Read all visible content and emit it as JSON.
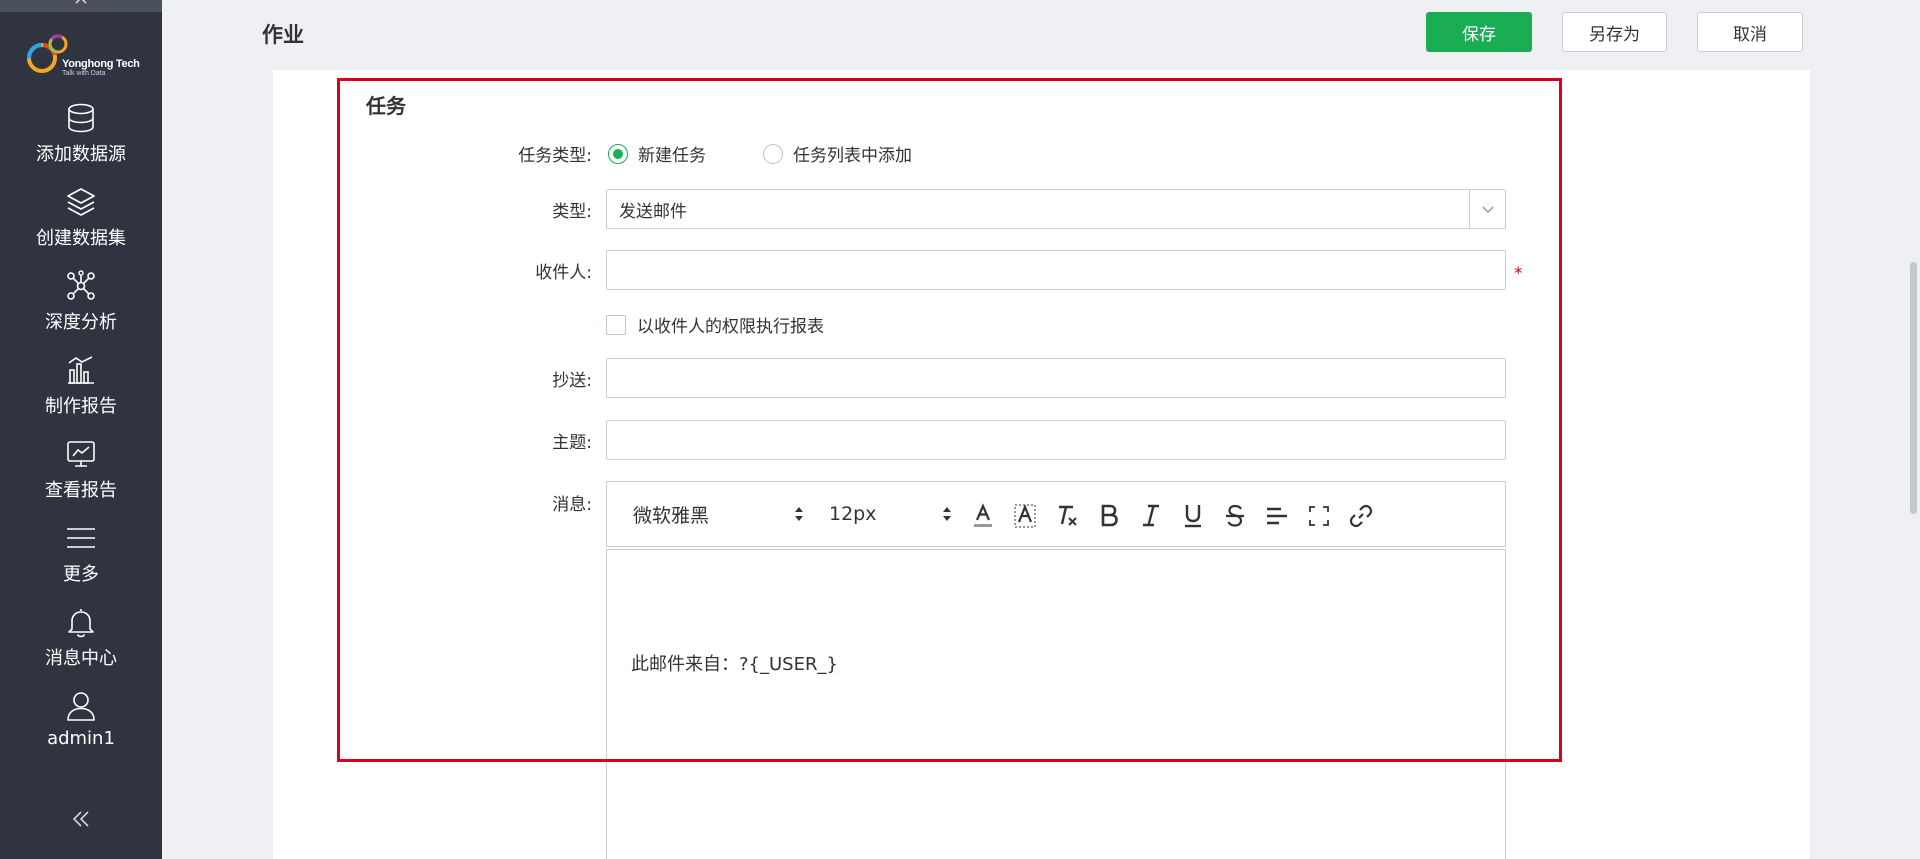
{
  "sidebar": {
    "logo": {
      "name": "Yonghong Tech",
      "tagline": "Talk with Data"
    },
    "items": [
      {
        "label": "添加数据源",
        "icon": "database-icon"
      },
      {
        "label": "创建数据集",
        "icon": "layers-icon"
      },
      {
        "label": "深度分析",
        "icon": "network-icon"
      },
      {
        "label": "制作报告",
        "icon": "bar-chart-icon"
      },
      {
        "label": "查看报告",
        "icon": "monitor-chart-icon"
      },
      {
        "label": "更多",
        "icon": "menu-icon"
      },
      {
        "label": "消息中心",
        "icon": "bell-icon"
      },
      {
        "label": "admin1",
        "icon": "user-icon"
      }
    ]
  },
  "header": {
    "title": "作业",
    "save_label": "保存",
    "save_as_label": "另存为",
    "cancel_label": "取消"
  },
  "task": {
    "section_title": "任务",
    "task_type_label": "任务类型:",
    "task_type_options": [
      {
        "label": "新建任务",
        "checked": true
      },
      {
        "label": "任务列表中添加",
        "checked": false
      }
    ],
    "type_label": "类型:",
    "type_value": "发送邮件",
    "recipient_label": "收件人:",
    "recipient_value": "",
    "required_mark": "*",
    "run_as_recipient_label": "以收件人的权限执行报表",
    "cc_label": "抄送:",
    "cc_value": "",
    "subject_label": "主题:",
    "subject_value": "",
    "message_label": "消息:",
    "editor": {
      "font_family": "微软雅黑",
      "font_size": "12px",
      "tools": [
        "font-color-icon",
        "highlight-icon",
        "clear-format-icon",
        "bold-icon",
        "italic-icon",
        "underline-icon",
        "strikethrough-icon",
        "align-icon",
        "fullscreen-icon",
        "link-icon"
      ],
      "content": "此邮件来自：?{_USER_}"
    }
  },
  "colors": {
    "accent": "#1aad54",
    "sidebar": "#2f3440",
    "highlight_border": "#d9001b"
  }
}
